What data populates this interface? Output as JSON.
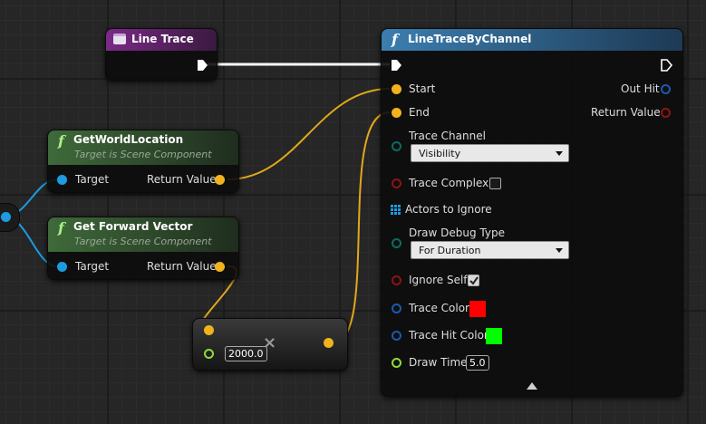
{
  "line_trace_node": {
    "title": "Line Trace",
    "icon": "event-node-icon",
    "header_color": "#7a2a86"
  },
  "trace_node": {
    "title": "LineTraceByChannel",
    "header_color": "#2f5f82",
    "inputs": {
      "start": "Start",
      "end": "End",
      "trace_channel": "Trace Channel",
      "trace_channel_value": "Visibility",
      "trace_complex": "Trace Complex",
      "actors_to_ignore": "Actors to Ignore",
      "draw_debug_type": "Draw Debug Type",
      "draw_debug_type_value": "For Duration",
      "ignore_self": "Ignore Self",
      "trace_color": "Trace Color",
      "trace_hit_color": "Trace Hit Color",
      "draw_time": "Draw Time",
      "draw_time_value": "5.0"
    },
    "outputs": {
      "out_hit": "Out Hit",
      "return_value": "Return Value"
    },
    "trace_complex_checked": false,
    "ignore_self_checked": true,
    "trace_color_value": "#ff0000",
    "trace_hit_color_value": "#00ff00"
  },
  "get_world_location_node": {
    "title": "GetWorldLocation",
    "subtitle": "Target is Scene Component",
    "target": "Target",
    "return_value": "Return Value",
    "header_color": "#3f6a3a"
  },
  "get_forward_vector_node": {
    "title": "Get Forward Vector",
    "subtitle": "Target is Scene Component",
    "target": "Target",
    "return_value": "Return Value",
    "header_color": "#3f6a3a"
  },
  "multiply_node": {
    "float_value": "2000.0",
    "operator_icon": "multiply-icon"
  },
  "colors": {
    "vector_pin": "#f1b31c",
    "object_pin": "#1d9be0",
    "exec_pin": "#ffffff",
    "struct_pin": "#1a5ab0",
    "bool_pin": "#8c1414",
    "byte_pin": "#0d6b62",
    "float_pin": "#8ddc3a"
  }
}
